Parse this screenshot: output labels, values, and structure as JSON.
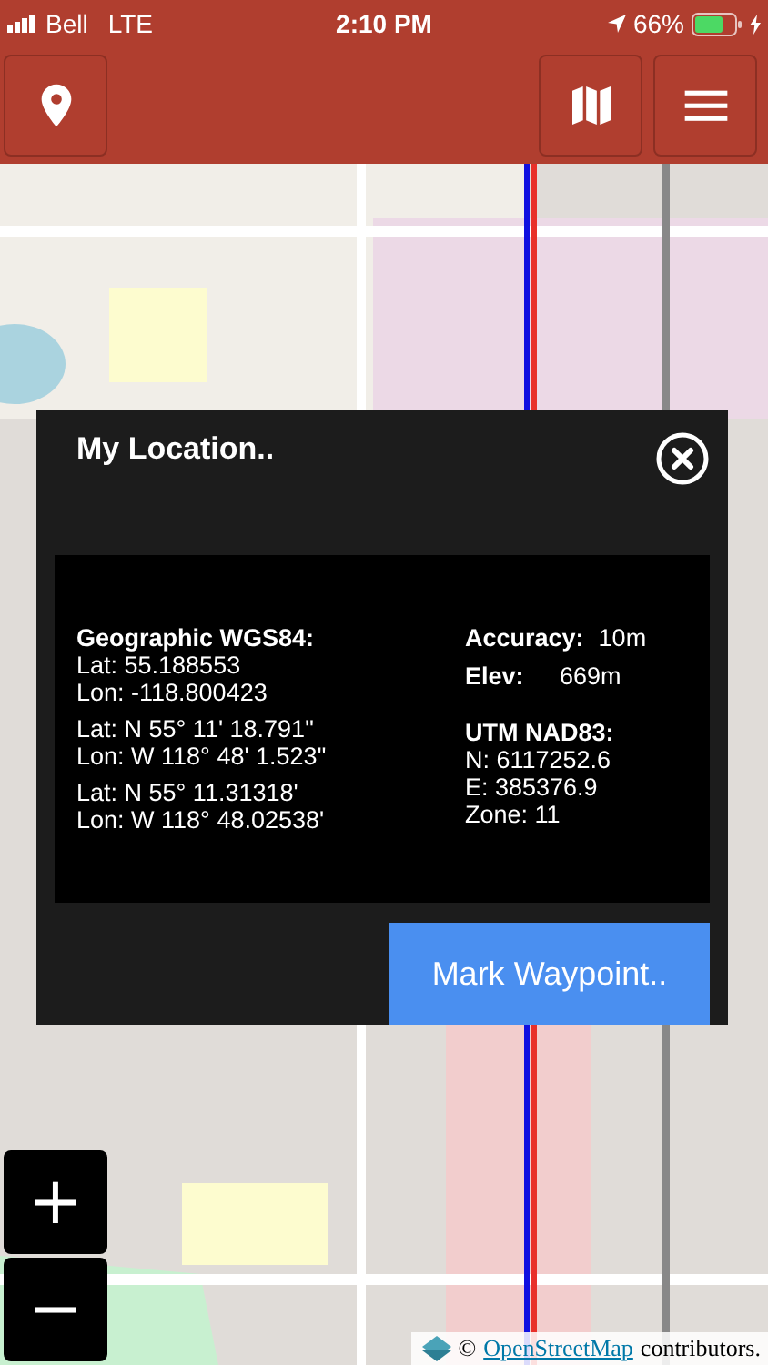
{
  "status_bar": {
    "carrier": "Bell",
    "network": "LTE",
    "time": "2:10 PM",
    "battery": "66%"
  },
  "dialog": {
    "title": "My Location..",
    "left": {
      "heading": "Geographic WGS84:",
      "groups": [
        {
          "lines": [
            "Lat: 55.188553",
            "Lon: -118.800423"
          ]
        },
        {
          "lines": [
            "Lat: N 55° 11' 18.791\"",
            "Lon: W 118° 48' 1.523\""
          ]
        },
        {
          "lines": [
            "Lat: N 55° 11.31318'",
            "Lon: W 118° 48.02538'"
          ]
        }
      ]
    },
    "right": {
      "fields": [
        {
          "label": "Accuracy:",
          "value": "10m"
        },
        {
          "label": "Elev:",
          "value": "669m"
        }
      ],
      "heading": "UTM NAD83:",
      "lines": [
        "N: 6117252.6",
        "E: 385376.9",
        "Zone: 11"
      ]
    },
    "button": "Mark Waypoint.."
  },
  "zoom": {
    "in": "+",
    "out": "−"
  },
  "attribution": {
    "prefix": "©",
    "link": "OpenStreetMap",
    "suffix": "contributors."
  }
}
